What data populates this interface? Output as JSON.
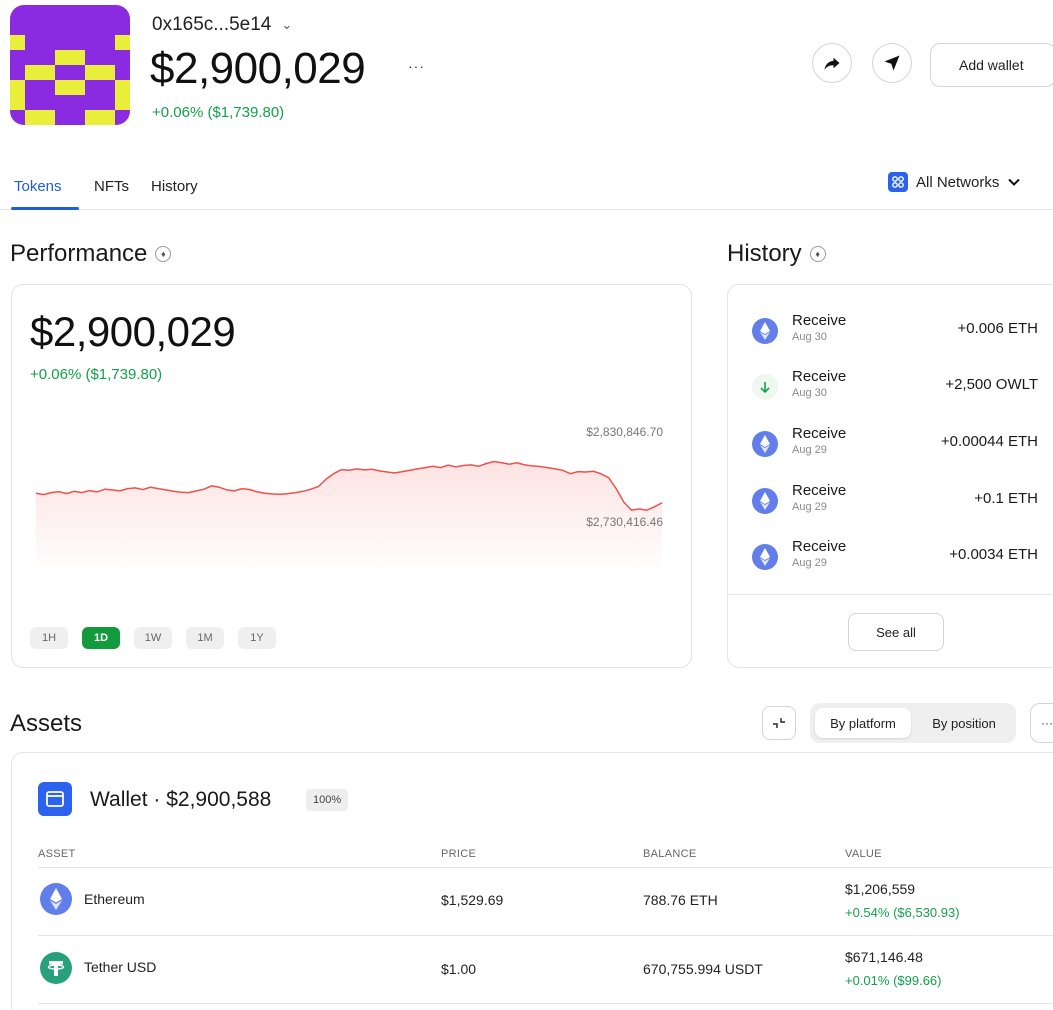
{
  "header": {
    "address": "0x165c...5e14",
    "total_value": "$2,900,029",
    "more_label": "···",
    "change": "+0.06% ($1,739.80)",
    "add_wallet_label": "Add wallet"
  },
  "tabs": [
    {
      "label": "Tokens",
      "active": true
    },
    {
      "label": "NFTs",
      "active": false
    },
    {
      "label": "History",
      "active": false
    }
  ],
  "network_selector": {
    "label": "All Networks"
  },
  "performance": {
    "title": "Performance",
    "value": "$2,900,029",
    "change": "+0.06% ($1,739.80)",
    "high_label": "$2,830,846.70",
    "low_label": "$2,730,416.46",
    "ranges": [
      {
        "label": "1H",
        "active": false
      },
      {
        "label": "1D",
        "active": true
      },
      {
        "label": "1W",
        "active": false
      },
      {
        "label": "1M",
        "active": false
      },
      {
        "label": "1Y",
        "active": false
      }
    ]
  },
  "chart_data": {
    "type": "area",
    "title": "",
    "xlabel": "",
    "ylabel": "",
    "line_color": "#f0504b",
    "annotations": [
      "$2,830,846.70",
      "$2,730,416.46"
    ],
    "ylim": [
      2730416.46,
      2830846.7
    ],
    "values": [
      2761000,
      2759000,
      2762000,
      2763500,
      2760500,
      2764000,
      2762000,
      2765000,
      2763000,
      2767000,
      2766000,
      2764500,
      2768000,
      2769000,
      2766500,
      2770000,
      2768000,
      2766000,
      2764000,
      2762500,
      2762000,
      2764500,
      2767000,
      2772000,
      2770000,
      2766000,
      2764500,
      2768000,
      2766500,
      2763000,
      2761000,
      2760000,
      2759500,
      2760500,
      2762000,
      2764000,
      2767000,
      2771000,
      2782000,
      2790000,
      2796000,
      2795000,
      2797000,
      2795500,
      2796500,
      2794000,
      2792500,
      2791000,
      2793000,
      2795000,
      2797000,
      2799000,
      2801000,
      2799000,
      2802500,
      2800000,
      2802000,
      2803000,
      2801000,
      2805000,
      2808000,
      2806000,
      2804000,
      2806000,
      2803000,
      2801500,
      2800500,
      2799000,
      2797000,
      2795000,
      2790000,
      2793000,
      2792500,
      2793500,
      2790000,
      2784000,
      2768000,
      2748000,
      2736000,
      2738000,
      2736000,
      2741000,
      2747000
    ]
  },
  "history": {
    "title": "History",
    "items": [
      {
        "type": "Receive",
        "date": "Aug 30",
        "amount": "+0.006 ETH",
        "icon": "ethereum-icon"
      },
      {
        "type": "Receive",
        "date": "Aug 30",
        "amount": "+2,500 OWLT",
        "icon": "arrow-down-icon"
      },
      {
        "type": "Receive",
        "date": "Aug 29",
        "amount": "+0.00044 ETH",
        "icon": "ethereum-icon"
      },
      {
        "type": "Receive",
        "date": "Aug 29",
        "amount": "+0.1 ETH",
        "icon": "ethereum-icon"
      },
      {
        "type": "Receive",
        "date": "Aug 29",
        "amount": "+0.0034 ETH",
        "icon": "ethereum-icon"
      }
    ],
    "see_all_label": "See all"
  },
  "assets": {
    "title": "Assets",
    "view_options": [
      "By platform",
      "By position"
    ],
    "more_label": "···",
    "wallet_title": "Wallet · $2,900,588",
    "wallet_share": "100%",
    "columns": [
      "ASSET",
      "PRICE",
      "BALANCE",
      "VALUE"
    ],
    "rows": [
      {
        "name": "Ethereum",
        "price": "$1,529.69",
        "balance": "788.76 ETH",
        "value": "$1,206,559",
        "change": "+0.54% ($6,530.93)",
        "icon": "ethereum-icon"
      },
      {
        "name": "Tether USD",
        "price": "$1.00",
        "balance": "670,755.994 USDT",
        "value": "$671,146.48",
        "change": "+0.01% ($99.66)",
        "icon": "tether-icon"
      }
    ]
  },
  "colors": {
    "accent_blue": "#1d5fd6",
    "positive_green": "#13a04a",
    "chart_red": "#f0504b",
    "avatar_purple": "#8a2be2",
    "avatar_yellow": "#e8ee3a",
    "ethereum_blue": "#627eea",
    "tether_green": "#26a17b"
  }
}
